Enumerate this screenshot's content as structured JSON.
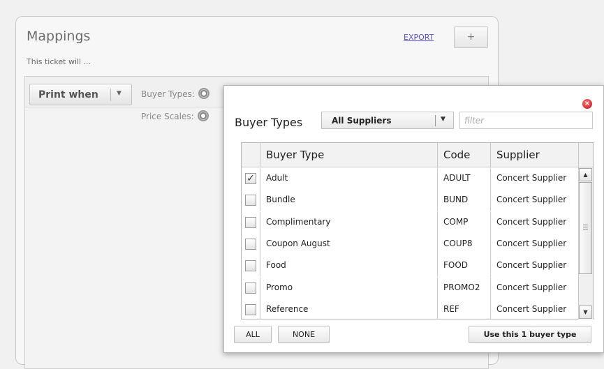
{
  "mappings": {
    "title": "Mappings",
    "subtitle": "This ticket will ...",
    "export_label": "EXPORT",
    "add_label": "+",
    "print_when_label": "Print when",
    "buyer_types_label": "Buyer Types:",
    "price_scales_label": "Price Scales:"
  },
  "popup": {
    "title": "Buyer Types",
    "close_label": "×",
    "supplier_select": "All Suppliers",
    "filter_placeholder": "filter",
    "columns": [
      "Buyer Type",
      "Code",
      "Supplier"
    ],
    "rows": [
      {
        "checked": true,
        "check_mark": "✓",
        "name": "Adult",
        "code": "ADULT",
        "supplier": "Concert Supplier"
      },
      {
        "checked": false,
        "check_mark": "",
        "name": "Bundle",
        "code": "BUND",
        "supplier": "Concert Supplier"
      },
      {
        "checked": false,
        "check_mark": "",
        "name": "Complimentary",
        "code": "COMP",
        "supplier": "Concert Supplier"
      },
      {
        "checked": false,
        "check_mark": "",
        "name": "Coupon August",
        "code": "COUP8",
        "supplier": "Concert Supplier"
      },
      {
        "checked": false,
        "check_mark": "",
        "name": "Food",
        "code": "FOOD",
        "supplier": "Concert Supplier"
      },
      {
        "checked": false,
        "check_mark": "",
        "name": "Promo",
        "code": "PROMO2",
        "supplier": "Concert Supplier"
      },
      {
        "checked": false,
        "check_mark": "",
        "name": "Reference",
        "code": "REF",
        "supplier": "Concert Supplier"
      }
    ],
    "all_label": "ALL",
    "none_label": "NONE",
    "use_label": "Use this 1 buyer type"
  }
}
